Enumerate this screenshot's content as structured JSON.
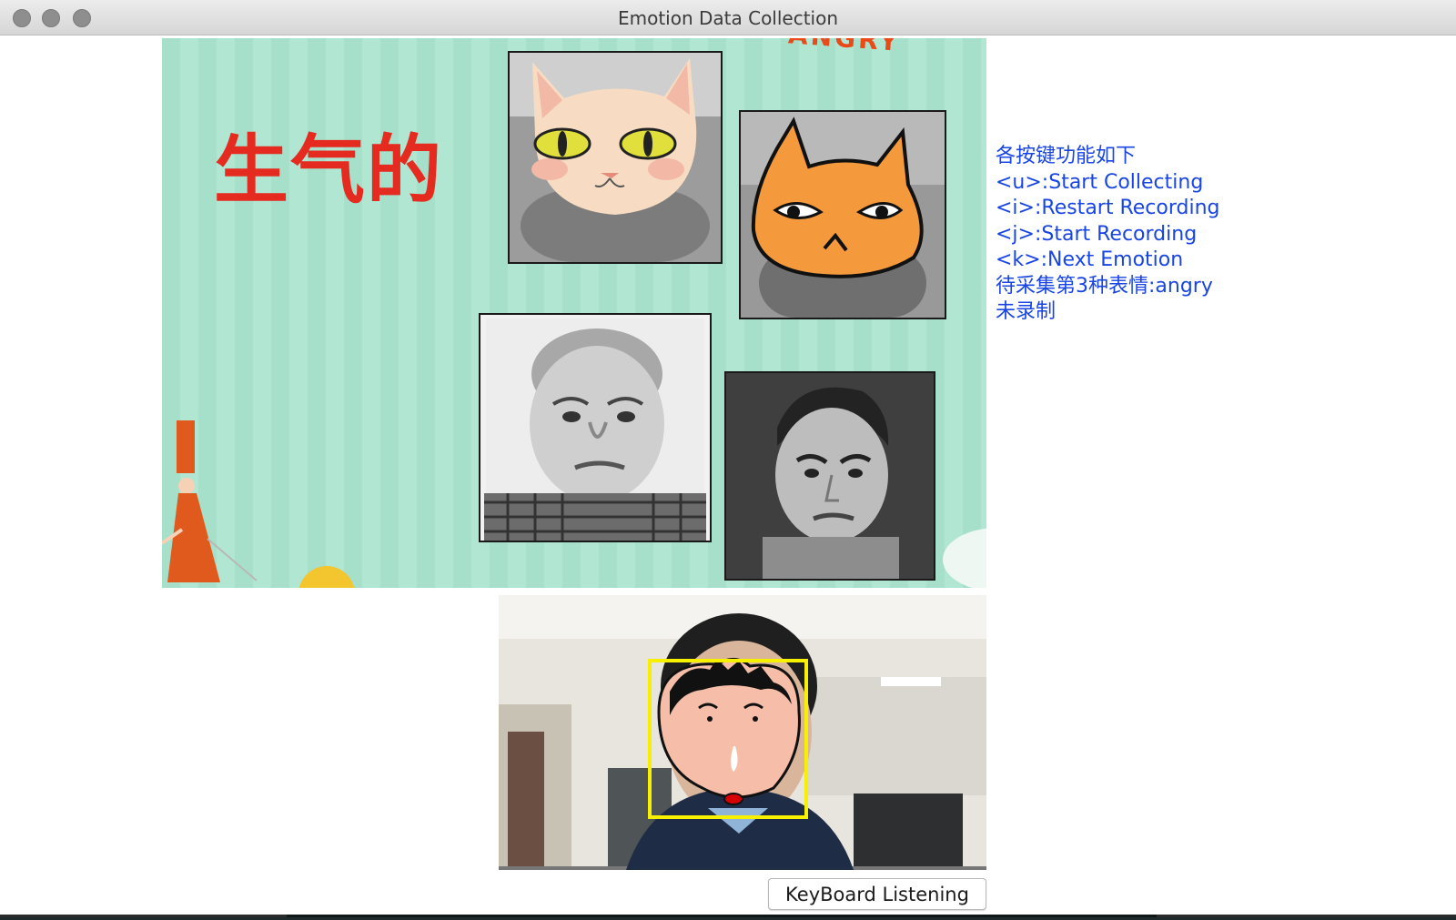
{
  "window": {
    "title": "Emotion Data Collection"
  },
  "prompt_panel": {
    "emotion_chinese": "生气的",
    "top_edge_text": "ANGRY"
  },
  "info_panel": {
    "lines": [
      "各按键功能如下",
      "<u>:Start Collecting",
      "<i>:Restart Recording",
      "<j>:Start Recording",
      "<k>:Next Emotion",
      "待采集第3种表情:angry",
      "未录制"
    ],
    "text_color": "#1845e4"
  },
  "buttons": {
    "keyboard_listening": "KeyBoard Listening"
  },
  "colors": {
    "panel_green": "#a6e0ca",
    "emotion_red": "#e52b20",
    "face_box_yellow": "#f7f000"
  }
}
